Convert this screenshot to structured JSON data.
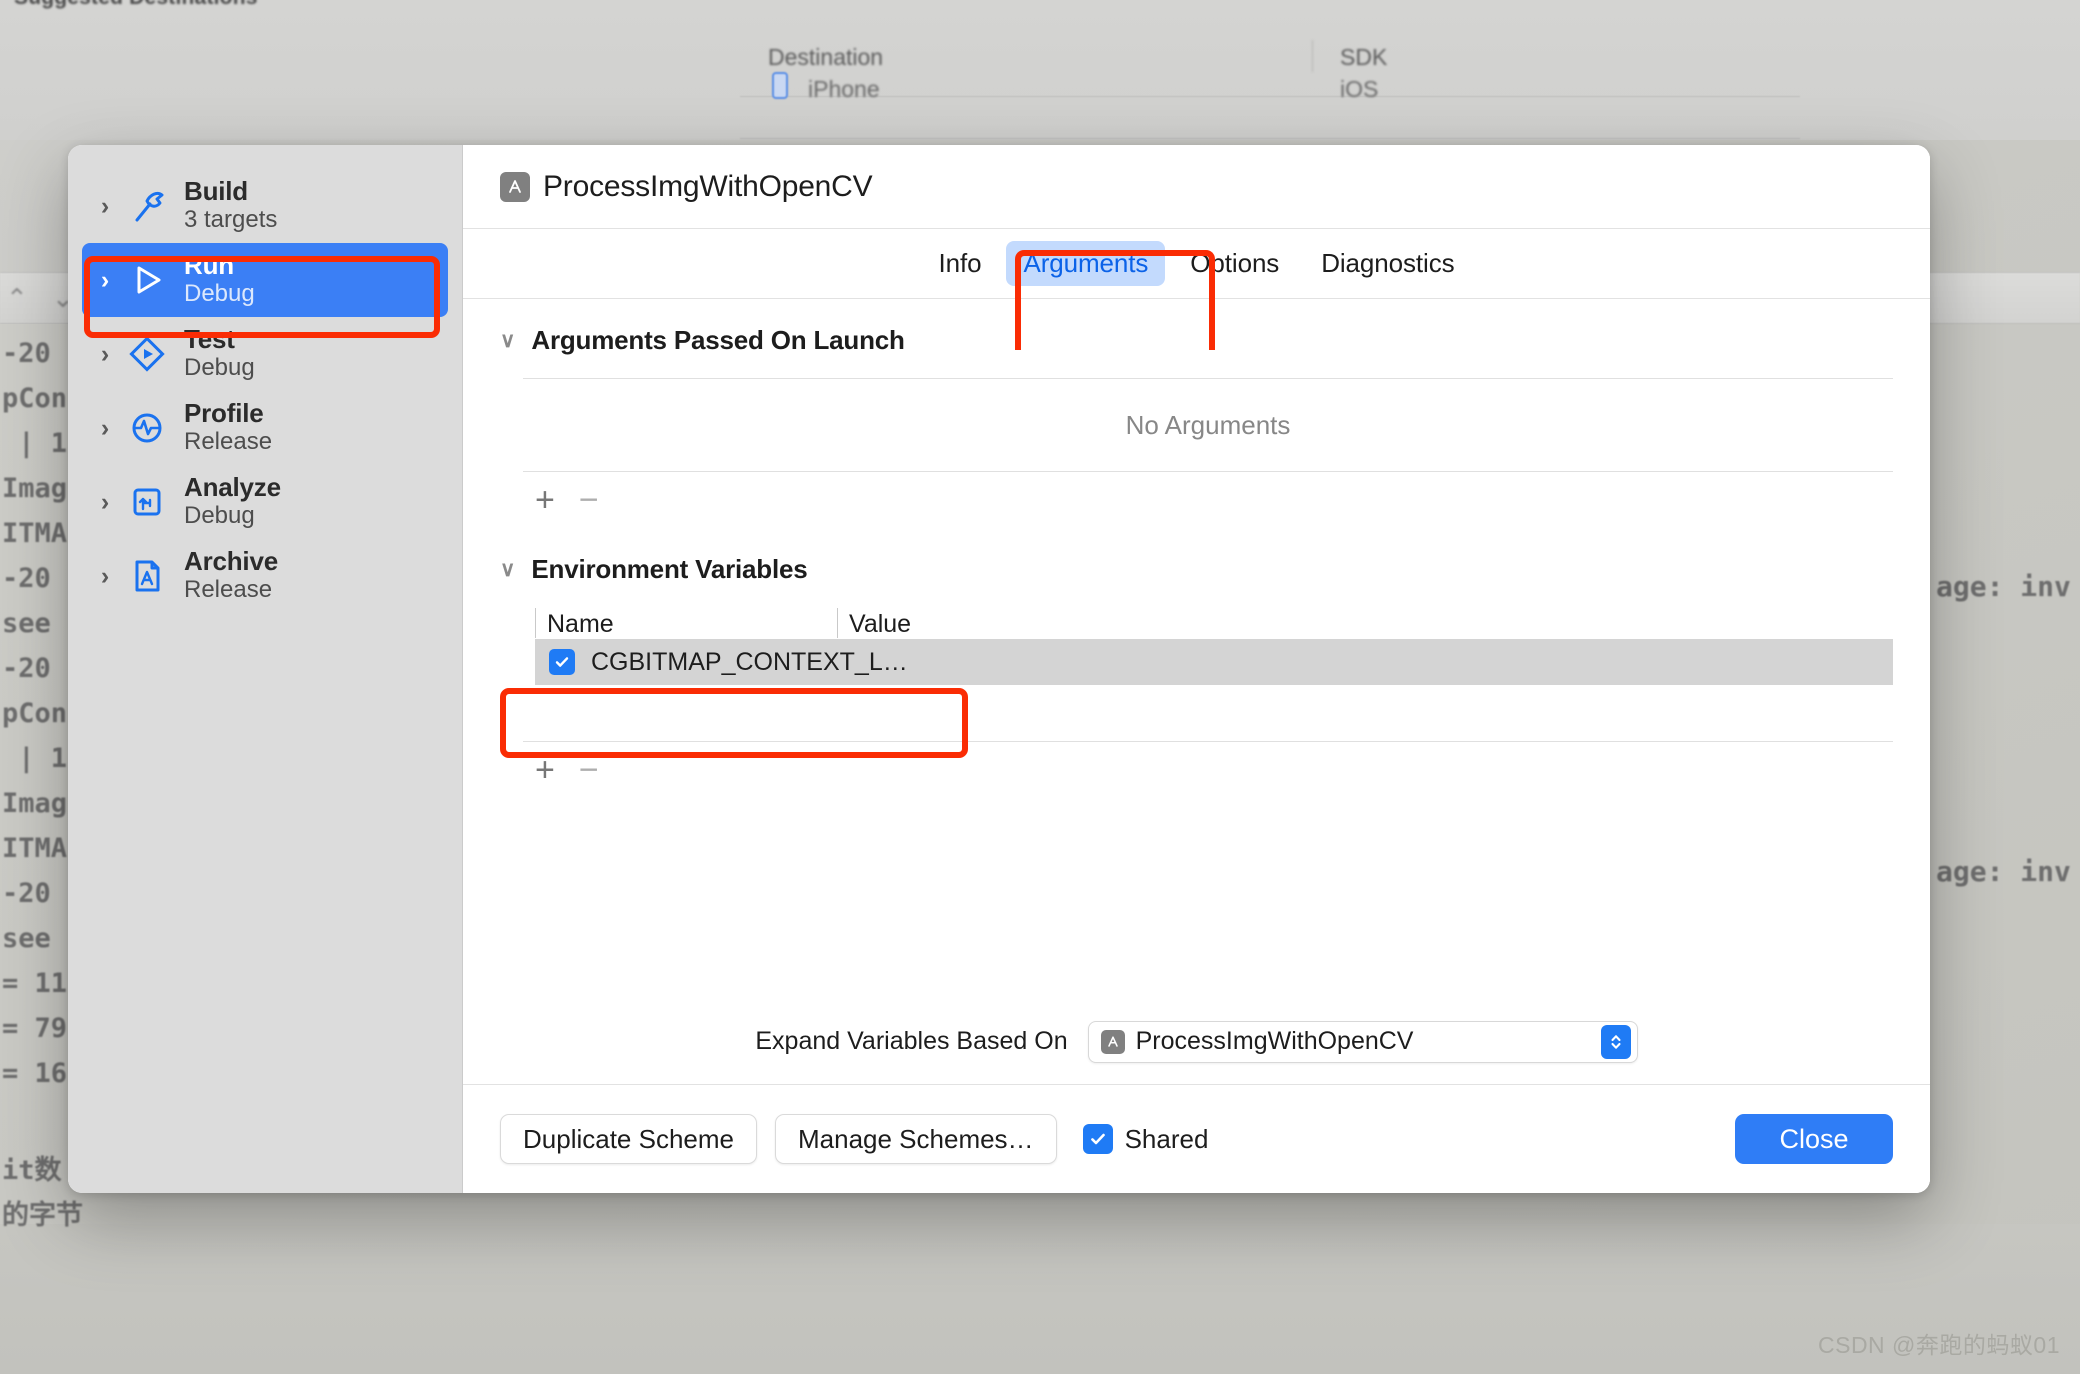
{
  "background": {
    "suggested_title": "Suggested Destinations",
    "destinations_table": {
      "columns": [
        "Destination",
        "SDK"
      ],
      "rows": [
        [
          "iPhone",
          "iOS"
        ]
      ]
    },
    "console_left_lines": [
      "-20",
      "pCon",
      " | 1",
      "Imag",
      "ITMA",
      "-20",
      "see",
      "-20",
      "pCon",
      " | 1",
      "Imag",
      "ITMA",
      "-20",
      "see",
      "= 11",
      "= 79",
      "= 16",
      "",
      "it数",
      "的字节"
    ],
    "console_right_lines": [
      "age: inv",
      "age: inv"
    ],
    "watermark": "CSDN @奔跑的蚂蚁01"
  },
  "sheet": {
    "title": "ProcessImgWithOpenCV",
    "app_icon": "xcode-app-icon",
    "sidebar": {
      "items": [
        {
          "name": "Build",
          "detail": "3 targets",
          "icon": "hammer-icon",
          "selected": false
        },
        {
          "name": "Run",
          "detail": "Debug",
          "icon": "play-icon",
          "selected": true
        },
        {
          "name": "Test",
          "detail": "Debug",
          "icon": "test-diamond-icon",
          "selected": false
        },
        {
          "name": "Profile",
          "detail": "Release",
          "icon": "profile-gauge-icon",
          "selected": false
        },
        {
          "name": "Analyze",
          "detail": "Debug",
          "icon": "analyze-icon",
          "selected": false
        },
        {
          "name": "Archive",
          "detail": "Release",
          "icon": "archive-icon",
          "selected": false
        }
      ]
    },
    "tabs": [
      {
        "label": "Info",
        "active": false
      },
      {
        "label": "Arguments",
        "active": true
      },
      {
        "label": "Options",
        "active": false
      },
      {
        "label": "Diagnostics",
        "active": false
      }
    ],
    "arguments_section": {
      "title": "Arguments Passed On Launch",
      "empty_text": "No Arguments",
      "add_label": "+",
      "remove_label": "−"
    },
    "env_section": {
      "title": "Environment Variables",
      "columns": [
        "Name",
        "Value"
      ],
      "rows": [
        {
          "enabled": true,
          "name": "CGBITMAP_CONTEXT_L…",
          "value": ""
        }
      ],
      "add_label": "+",
      "remove_label": "−"
    },
    "expand_variables": {
      "label": "Expand Variables Based On",
      "value": "ProcessImgWithOpenCV"
    },
    "footer": {
      "duplicate_scheme": "Duplicate Scheme",
      "manage_schemes": "Manage Schemes…",
      "shared_label": "Shared",
      "shared_checked": true,
      "close": "Close"
    }
  },
  "colors": {
    "accent_blue": "#3b7ff5",
    "tab_active_bg": "#c3dafd",
    "tab_active_fg": "#0b62e8",
    "annotation_red": "#fa2c04",
    "checkbox_blue": "#1f7bf5",
    "row_highlight": "#d4d4d4"
  }
}
